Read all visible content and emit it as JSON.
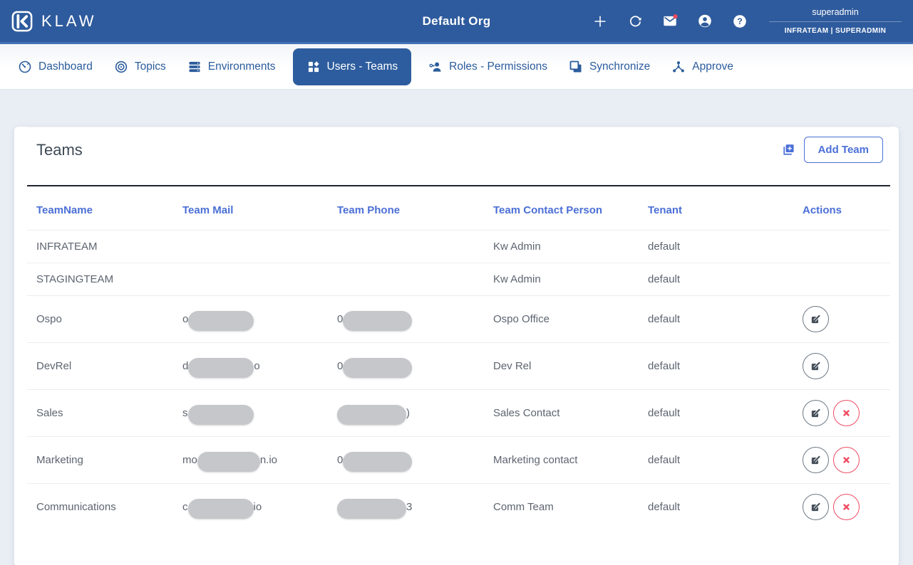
{
  "header": {
    "brand": "KLAW",
    "title": "Default Org",
    "icons": [
      "plus-icon",
      "refresh-icon",
      "mail-icon (unread badge)",
      "account-icon",
      "help-icon"
    ],
    "user": {
      "name": "superadmin",
      "role": "INFRATEAM | SUPERADMIN"
    }
  },
  "nav": {
    "items": [
      {
        "label": "Dashboard",
        "icon": "gauge-icon",
        "active": false
      },
      {
        "label": "Topics",
        "icon": "target-icon",
        "active": false
      },
      {
        "label": "Environments",
        "icon": "server-stack-icon",
        "active": false
      },
      {
        "label": "Users - Teams",
        "icon": "tiles-icon",
        "active": true
      },
      {
        "label": "Roles - Permissions",
        "icon": "person-key-icon",
        "active": false
      },
      {
        "label": "Synchronize",
        "icon": "layers-icon",
        "active": false
      },
      {
        "label": "Approve",
        "icon": "hub-icon",
        "active": false
      }
    ]
  },
  "main": {
    "heading": "Teams",
    "add_button": "Add Team",
    "table": {
      "columns": [
        "TeamName",
        "Team Mail",
        "Team Phone",
        "Team Contact Person",
        "Tenant",
        "Actions"
      ],
      "rows": [
        {
          "team": "INFRATEAM",
          "mail": {
            "prefix": "",
            "suffix": "",
            "redacted": false
          },
          "phone": {
            "prefix": "",
            "suffix": "",
            "redacted": false
          },
          "contact": "Kw Admin",
          "tenant": "default",
          "actions": {
            "edit": false,
            "delete": false
          }
        },
        {
          "team": "STAGINGTEAM",
          "mail": {
            "prefix": "",
            "suffix": "",
            "redacted": false
          },
          "phone": {
            "prefix": "",
            "suffix": "",
            "redacted": false
          },
          "contact": "Kw Admin",
          "tenant": "default",
          "actions": {
            "edit": false,
            "delete": false
          }
        },
        {
          "team": "Ospo",
          "mail": {
            "prefix": "o",
            "suffix": "",
            "redacted": true
          },
          "phone": {
            "prefix": "0",
            "suffix": "",
            "redacted": true
          },
          "contact": "Ospo Office",
          "tenant": "default",
          "actions": {
            "edit": true,
            "delete": false
          }
        },
        {
          "team": "DevRel",
          "mail": {
            "prefix": "d",
            "suffix": "o",
            "redacted": true
          },
          "phone": {
            "prefix": "0",
            "suffix": "",
            "redacted": true
          },
          "contact": "Dev Rel",
          "tenant": "default",
          "actions": {
            "edit": true,
            "delete": false
          }
        },
        {
          "team": "Sales",
          "mail": {
            "prefix": "s",
            "suffix": "",
            "redacted": true
          },
          "phone": {
            "prefix": "",
            "suffix": ")",
            "redacted": true
          },
          "contact": "Sales Contact",
          "tenant": "default",
          "actions": {
            "edit": true,
            "delete": true
          }
        },
        {
          "team": "Marketing",
          "mail": {
            "prefix": "mo",
            "suffix": "n.io",
            "redacted": true
          },
          "phone": {
            "prefix": "0",
            "suffix": "",
            "redacted": true
          },
          "contact": "Marketing contact",
          "tenant": "default",
          "actions": {
            "edit": true,
            "delete": true
          }
        },
        {
          "team": "Communications",
          "mail": {
            "prefix": "c",
            "suffix": "io",
            "redacted": true
          },
          "phone": {
            "prefix": "",
            "suffix": "3",
            "redacted": true
          },
          "contact": "Comm Team",
          "tenant": "default",
          "actions": {
            "edit": true,
            "delete": true
          }
        }
      ]
    }
  },
  "colors": {
    "header_bg": "#2e5b9d",
    "header_accent_line": "#4272b4",
    "nav_active_bg": "#2d5d9e",
    "nav_text": "#2b5c9c",
    "table_header_text": "#4b6fd6",
    "button_blue": "#4a6fd8",
    "delete_red": "#ee4b62",
    "redaction_pill": "#c6c7ca",
    "body_bg": "#e9edf4",
    "cell_text": "#5d6470"
  }
}
